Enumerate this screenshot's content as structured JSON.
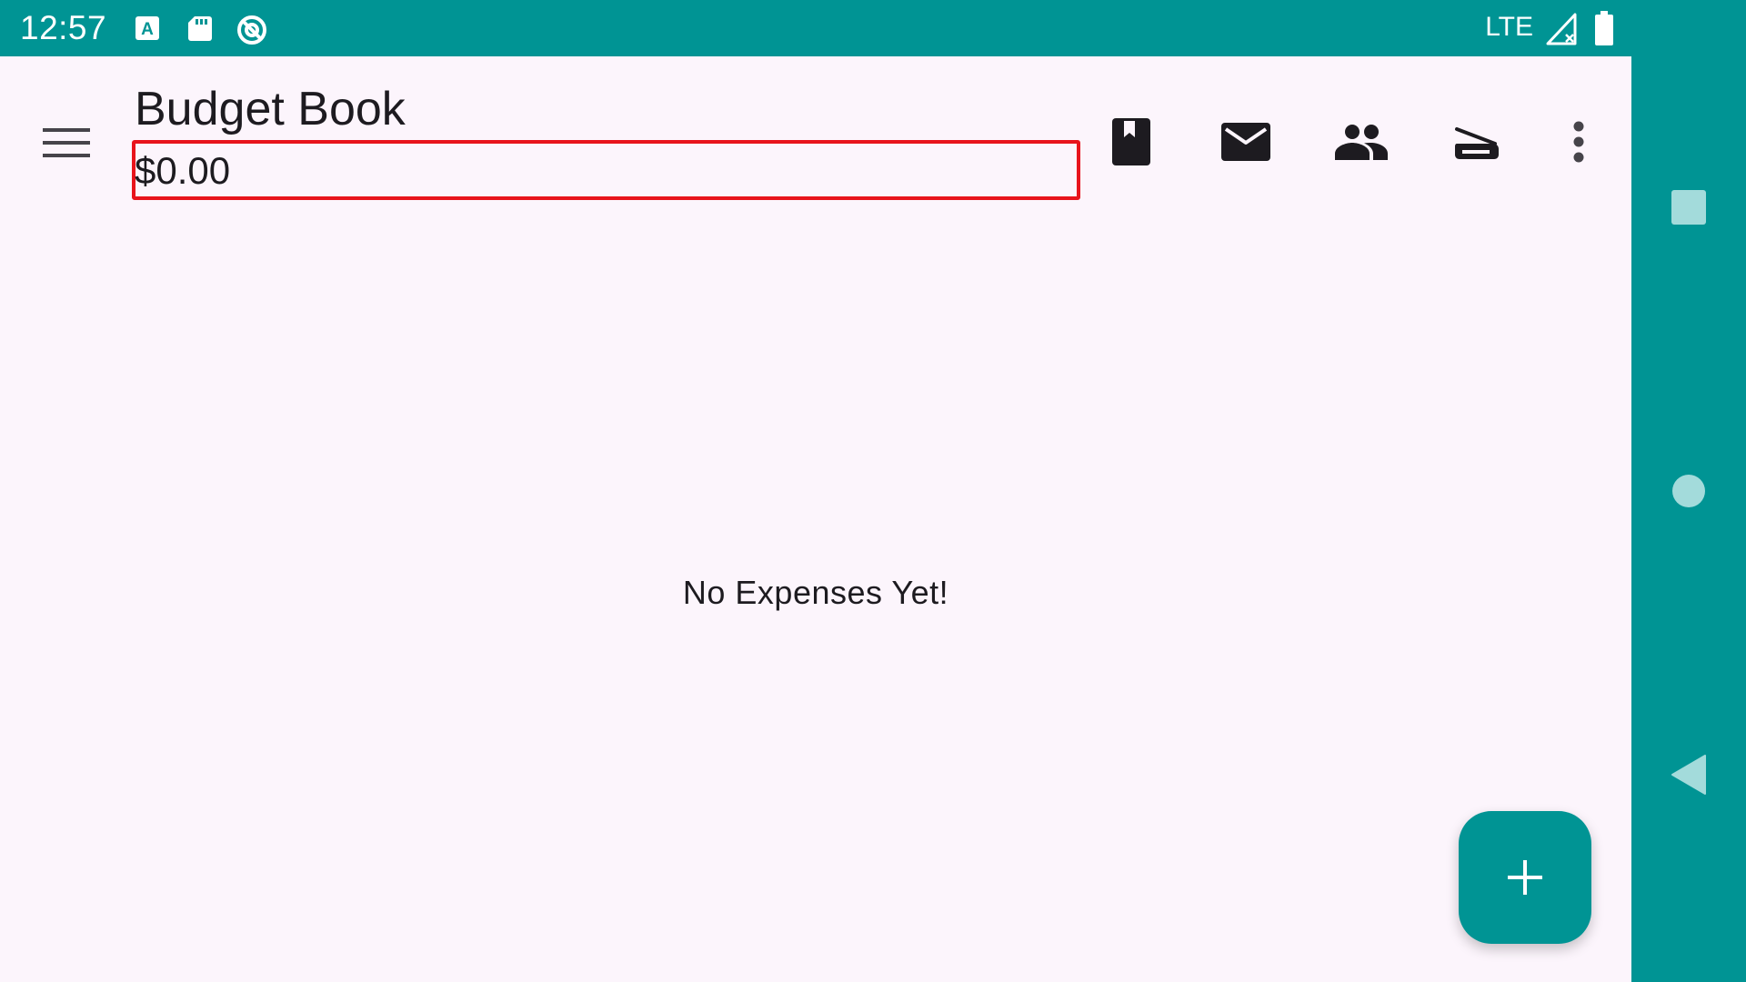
{
  "status_bar": {
    "time": "12:57",
    "network": "LTE",
    "icons": [
      "keyboard-a-icon",
      "sd-card-icon",
      "dnd-icon",
      "signal-icon",
      "battery-icon"
    ]
  },
  "toolbar": {
    "title": "Budget Book",
    "balance": "$0.00",
    "actions": [
      "book-icon",
      "mail-icon",
      "people-icon",
      "scanner-icon",
      "more-vert-icon"
    ]
  },
  "main": {
    "empty_message": "No Expenses Yet!"
  },
  "fab": {
    "icon": "add-icon"
  },
  "navigation": {
    "buttons": [
      "recents-icon",
      "home-icon",
      "back-icon"
    ]
  },
  "colors": {
    "primary": "#009494",
    "background": "#fcf5fc",
    "highlight": "#e8141c"
  }
}
